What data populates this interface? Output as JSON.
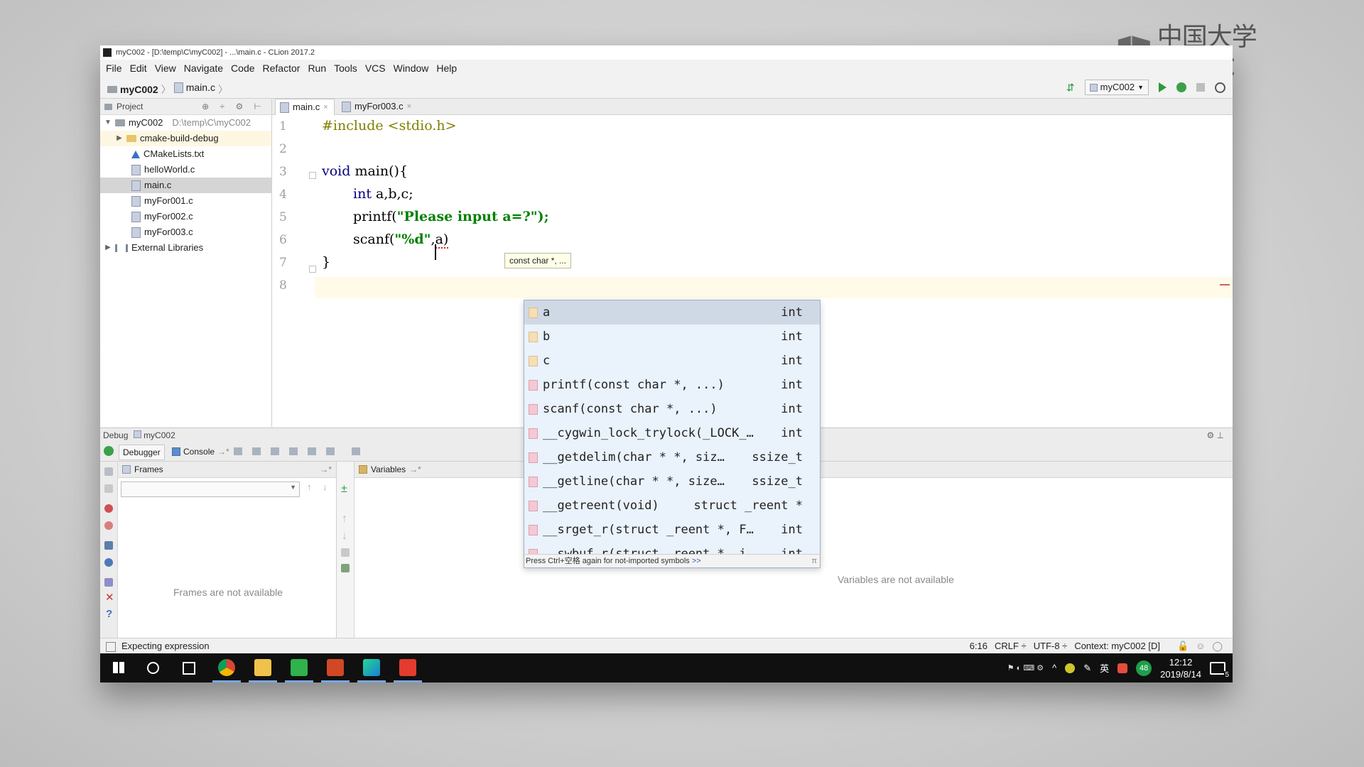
{
  "watermark": {
    "text": "中国大学MOOC"
  },
  "window": {
    "title": "myC002 - [D:\\temp\\C\\myC002] - ...\\main.c - CLion 2017.2"
  },
  "menu": [
    "File",
    "Edit",
    "View",
    "Navigate",
    "Code",
    "Refactor",
    "Run",
    "Tools",
    "VCS",
    "Window",
    "Help"
  ],
  "navbar": {
    "project": "myC002",
    "file": "main.c",
    "run_config": "myC002",
    "icons": [
      "vcs-update-icon",
      "run-icon",
      "debug-icon",
      "stop-icon",
      "search-icon"
    ]
  },
  "project_panel": {
    "header": "Project",
    "root": {
      "name": "myC002",
      "path": "D:\\temp\\C\\myC002"
    },
    "items": [
      {
        "name": "cmake-build-debug",
        "type": "folder"
      },
      {
        "name": "CMakeLists.txt",
        "type": "cmake"
      },
      {
        "name": "helloWorld.c",
        "type": "c"
      },
      {
        "name": "main.c",
        "type": "c",
        "selected": true
      },
      {
        "name": "myFor001.c",
        "type": "c"
      },
      {
        "name": "myFor002.c",
        "type": "c"
      },
      {
        "name": "myFor003.c",
        "type": "c"
      }
    ],
    "external": "External Libraries"
  },
  "editor": {
    "tabs": [
      {
        "label": "main.c",
        "active": true
      },
      {
        "label": "myFor003.c",
        "active": false
      }
    ],
    "line_numbers": [
      "1",
      "2",
      "3",
      "4",
      "5",
      "6",
      "7",
      "8"
    ],
    "lines": {
      "l1_pp": "#include",
      "l1_rest": " <stdio.h>",
      "l3_kw": "void",
      "l3_rest": " main(){",
      "l4_kw": "int",
      "l4_rest": " a,b,c;",
      "l5_a": "printf(",
      "l5_hidden": "\"Please ",
      "l5_b": "input a=?\");",
      "l6_a": "scanf(",
      "l6_str": "\"%d\"",
      "l6_b": ",",
      "l6_c": "a",
      "l6_d": ")",
      "l7": "}"
    },
    "cursor": {
      "line": 6,
      "column": 16
    }
  },
  "param_hint": "const char *, ...",
  "completion": {
    "items": [
      {
        "name": "a",
        "type": "int",
        "kind": "variable"
      },
      {
        "name": "b",
        "type": "int",
        "kind": "variable"
      },
      {
        "name": "c",
        "type": "int",
        "kind": "variable"
      },
      {
        "name": "printf(const char *, ...)",
        "type": "int",
        "kind": "function"
      },
      {
        "name": "scanf(const char *, ...)",
        "type": "int",
        "kind": "function"
      },
      {
        "name": "__cygwin_lock_trylock(_LOCK_…",
        "type": "int",
        "kind": "function"
      },
      {
        "name": "__getdelim(char * *, siz…",
        "type": "ssize_t",
        "kind": "function"
      },
      {
        "name": "__getline(char * *, size…",
        "type": "ssize_t",
        "kind": "function"
      },
      {
        "name": "__getreent(void)",
        "type": "struct _reent *",
        "kind": "function"
      },
      {
        "name": "__srget_r(struct _reent *, F…",
        "type": "int",
        "kind": "function"
      },
      {
        "name": "__swbuf_r(struct _reent *, i…",
        "type": "int",
        "kind": "function"
      }
    ],
    "footer": "Press Ctrl+空格 again for not-imported symbols",
    "footer_link": ">>",
    "pin": "π"
  },
  "debug": {
    "title": "Debug",
    "config": "myC002",
    "tabs": [
      "Debugger",
      "Console"
    ],
    "frames_header": "Frames",
    "variables_header": "Variables",
    "frames_empty": "Frames are not available",
    "variables_empty": "Variables are not available"
  },
  "status": {
    "message": "Expecting expression",
    "position": "6:16",
    "line_sep": "CRLF ÷",
    "encoding": "UTF-8 ÷",
    "context": "Context: myC002 [D]"
  },
  "taskbar": {
    "apps": [
      "start-icon",
      "cortana-icon",
      "taskview-icon",
      "chrome-icon",
      "explorer-icon",
      "green-c-icon",
      "powerpoint-icon",
      "clion-icon",
      "red-c-icon"
    ],
    "tray_lang": "英",
    "badge": "48",
    "time": "12:12",
    "date": "2019/8/14",
    "notifications": "5"
  },
  "colors": {
    "accent": "#2b9a39",
    "selection": "#cfd9e5",
    "popup_bg": "#eaf2fb",
    "current_line": "#fffbe8"
  }
}
